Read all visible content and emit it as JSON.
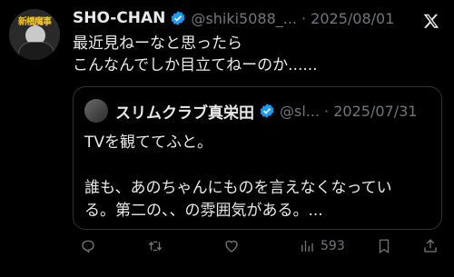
{
  "post": {
    "author_name": "SHO-CHAN",
    "handle": "@shiki5088_...",
    "date": "· 2025/08/01",
    "text": "最近見ねーなと思ったら\nこんなんでしか目立てねーのか......",
    "avatar_text": "新橋魔事"
  },
  "quote": {
    "author_name": "スリムクラブ真栄田",
    "handle": "@sl...",
    "date": "· 2025/07/31",
    "text": "TVを観ててふと。\n\n誰も、あのちゃんにものを言えなくなってい\nる。第二の、、の雰囲気がある。..."
  },
  "actions": {
    "views": "593"
  },
  "colors": {
    "background": "#000000",
    "text": "#e7e9ea",
    "muted": "#71767b",
    "verified": "#1d9bf0",
    "border": "#2f3336"
  },
  "icons": [
    "verified-badge-icon",
    "x-logo-icon",
    "reply-icon",
    "retweet-icon",
    "like-icon",
    "views-icon",
    "bookmark-icon",
    "share-icon"
  ]
}
